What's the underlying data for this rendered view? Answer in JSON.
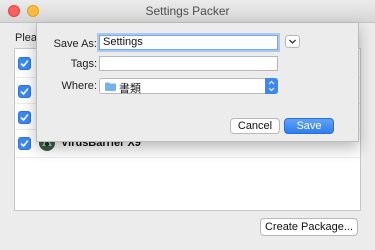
{
  "window": {
    "title": "Settings Packer"
  },
  "main": {
    "prompt": "Pleas",
    "rows": [
      {
        "checked": true,
        "name": ""
      },
      {
        "checked": true,
        "name": ""
      },
      {
        "checked": true,
        "name": ""
      },
      {
        "checked": true,
        "name": "VirusBarrier X9",
        "icon": "virusbarrier-icon"
      }
    ],
    "create_button": "Create Package..."
  },
  "sheet": {
    "save_as_label": "Save As:",
    "save_as_value": "Settings",
    "tags_label": "Tags:",
    "tags_value": "",
    "where_label": "Where:",
    "where_value": "書類",
    "cancel_label": "Cancel",
    "save_label": "Save"
  },
  "colors": {
    "accent": "#3a87f5"
  }
}
